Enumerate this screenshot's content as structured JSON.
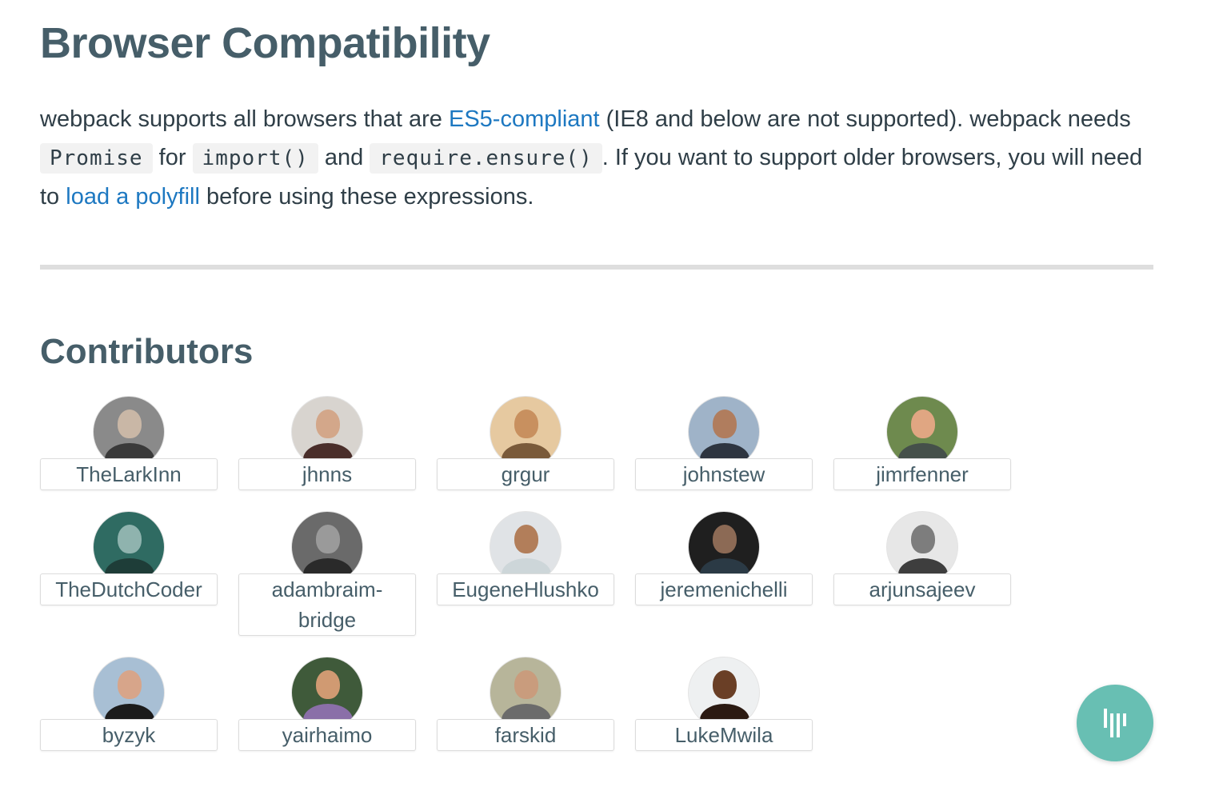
{
  "heading": "Browser Compatibility",
  "intro": {
    "t1": "webpack supports all browsers that are ",
    "link1": "ES5-compliant",
    "t2": " (IE8 and below are not supported). webpack needs ",
    "code1": "Promise",
    "t3": " for ",
    "code2": "import()",
    "t4": " and ",
    "code3": "require.ensure()",
    "t5": ". If you want to support older browsers, you will need to ",
    "link2": "load a polyfill",
    "t6": " before using these expressions."
  },
  "contributors_heading": "Contributors",
  "contributors": [
    {
      "name": "TheLarkInn",
      "bg": "#8a8a8a",
      "skin": "#c9b7a6",
      "shirt": "#3a3a3a"
    },
    {
      "name": "jhnns",
      "bg": "#d8d4cf",
      "skin": "#d3a78a",
      "shirt": "#4a2e2a"
    },
    {
      "name": "grgur",
      "bg": "#e6c9a0",
      "skin": "#c8905f",
      "shirt": "#7a5a3a"
    },
    {
      "name": "johnstew",
      "bg": "#9fb3c8",
      "skin": "#b07d5e",
      "shirt": "#2e3540"
    },
    {
      "name": "jimrfenner",
      "bg": "#6e8a4e",
      "skin": "#e0a682",
      "shirt": "#45504a"
    },
    {
      "name": "TheDutchCoder",
      "bg": "#2f6b62",
      "skin": "#8fb3ae",
      "shirt": "#1e3d38"
    },
    {
      "name": "adambraim-bridge",
      "bg": "#6a6a6a",
      "skin": "#9a9a9a",
      "shirt": "#2a2a2a"
    },
    {
      "name": "EugeneHlushko",
      "bg": "#e0e3e6",
      "skin": "#b27e5a",
      "shirt": "#cdd6d9"
    },
    {
      "name": "jeremenichelli",
      "bg": "#1f1f1f",
      "skin": "#8c6a55",
      "shirt": "#2b3a45"
    },
    {
      "name": "arjunsajeev",
      "bg": "#e7e7e7",
      "skin": "#7d7d7d",
      "shirt": "#3e3e3e"
    },
    {
      "name": "byzyk",
      "bg": "#a8bfd4",
      "skin": "#d7a58a",
      "shirt": "#1b1b1b"
    },
    {
      "name": "yairhaimo",
      "bg": "#3f5a3a",
      "skin": "#d09a72",
      "shirt": "#8a6fa8"
    },
    {
      "name": "farskid",
      "bg": "#b7b59a",
      "skin": "#c99c7d",
      "shirt": "#6b6b6b"
    },
    {
      "name": "LukeMwila",
      "bg": "#eef0f1",
      "skin": "#6a3f26",
      "shirt": "#2b1a12"
    }
  ],
  "colors": {
    "heading": "#465e69",
    "link": "#1d78c1",
    "gitter": "#68bfb3"
  },
  "chat_button_icon": "gitter-icon"
}
